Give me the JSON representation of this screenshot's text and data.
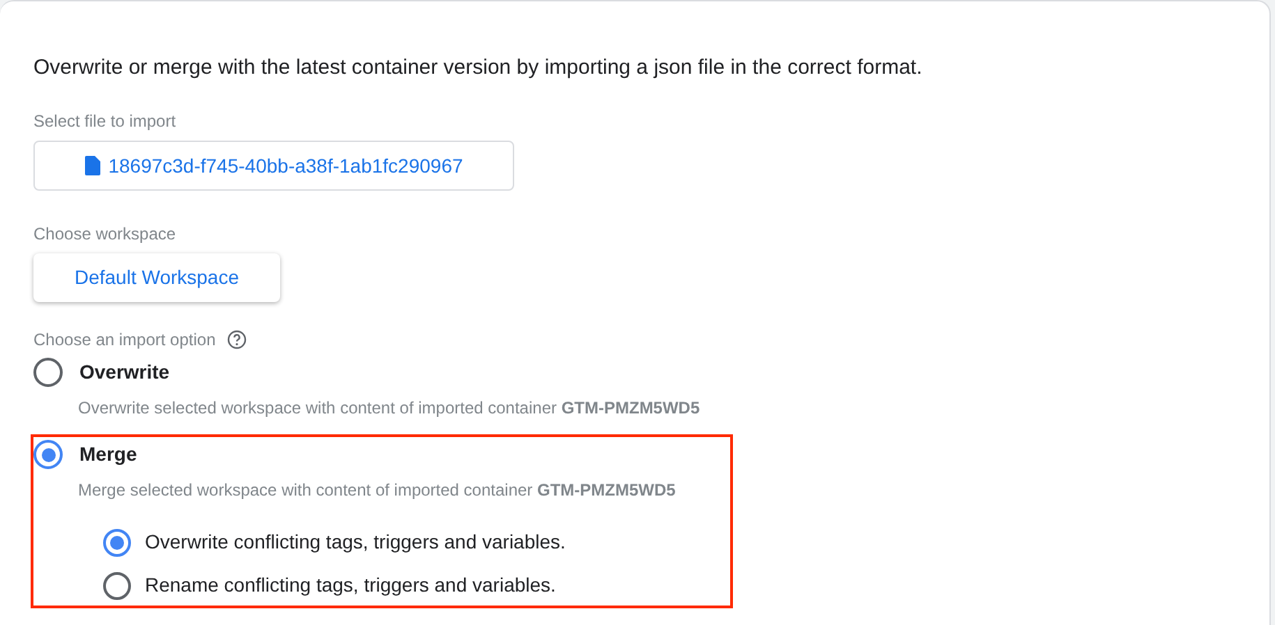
{
  "intro": "Overwrite or merge with the latest container version by importing a json file in the correct format.",
  "file_field": {
    "label": "Select file to import",
    "value": "18697c3d-f745-40bb-a38f-1ab1fc290967"
  },
  "workspace_field": {
    "label": "Choose workspace",
    "value": "Default Workspace"
  },
  "import_option": {
    "label": "Choose an import option",
    "options": [
      {
        "label": "Overwrite",
        "selected": false,
        "highlighted": false,
        "description": "Overwrite selected workspace with content of imported container **GTM-PMZM5WD5**"
      },
      {
        "label": "Merge",
        "selected": true,
        "highlighted": true,
        "description": "Merge selected workspace with content of imported container **GTM-PMZM5WD5**",
        "sub_options": [
          {
            "label": "Overwrite conflicting tags, triggers and variables.",
            "selected": true
          },
          {
            "label": "Rename conflicting tags, triggers and variables.",
            "selected": false
          }
        ]
      }
    ]
  }
}
